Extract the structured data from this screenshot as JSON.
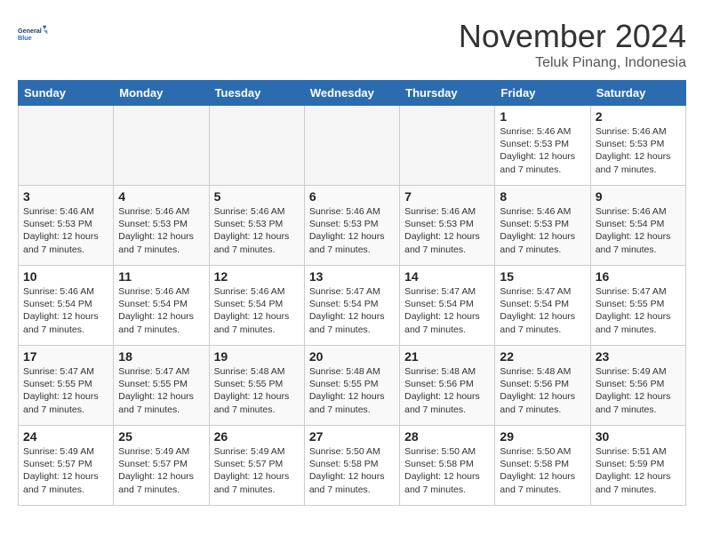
{
  "logo": {
    "line1": "General",
    "line2": "Blue"
  },
  "title": "November 2024",
  "location": "Teluk Pinang, Indonesia",
  "weekdays": [
    "Sunday",
    "Monday",
    "Tuesday",
    "Wednesday",
    "Thursday",
    "Friday",
    "Saturday"
  ],
  "weeks": [
    [
      {
        "day": "",
        "empty": true
      },
      {
        "day": "",
        "empty": true
      },
      {
        "day": "",
        "empty": true
      },
      {
        "day": "",
        "empty": true
      },
      {
        "day": "",
        "empty": true
      },
      {
        "day": "1",
        "sunrise": "5:46 AM",
        "sunset": "5:53 PM",
        "daylight": "12 hours and 7 minutes."
      },
      {
        "day": "2",
        "sunrise": "5:46 AM",
        "sunset": "5:53 PM",
        "daylight": "12 hours and 7 minutes."
      }
    ],
    [
      {
        "day": "3",
        "sunrise": "5:46 AM",
        "sunset": "5:53 PM",
        "daylight": "12 hours and 7 minutes."
      },
      {
        "day": "4",
        "sunrise": "5:46 AM",
        "sunset": "5:53 PM",
        "daylight": "12 hours and 7 minutes."
      },
      {
        "day": "5",
        "sunrise": "5:46 AM",
        "sunset": "5:53 PM",
        "daylight": "12 hours and 7 minutes."
      },
      {
        "day": "6",
        "sunrise": "5:46 AM",
        "sunset": "5:53 PM",
        "daylight": "12 hours and 7 minutes."
      },
      {
        "day": "7",
        "sunrise": "5:46 AM",
        "sunset": "5:53 PM",
        "daylight": "12 hours and 7 minutes."
      },
      {
        "day": "8",
        "sunrise": "5:46 AM",
        "sunset": "5:53 PM",
        "daylight": "12 hours and 7 minutes."
      },
      {
        "day": "9",
        "sunrise": "5:46 AM",
        "sunset": "5:54 PM",
        "daylight": "12 hours and 7 minutes."
      }
    ],
    [
      {
        "day": "10",
        "sunrise": "5:46 AM",
        "sunset": "5:54 PM",
        "daylight": "12 hours and 7 minutes."
      },
      {
        "day": "11",
        "sunrise": "5:46 AM",
        "sunset": "5:54 PM",
        "daylight": "12 hours and 7 minutes."
      },
      {
        "day": "12",
        "sunrise": "5:46 AM",
        "sunset": "5:54 PM",
        "daylight": "12 hours and 7 minutes."
      },
      {
        "day": "13",
        "sunrise": "5:47 AM",
        "sunset": "5:54 PM",
        "daylight": "12 hours and 7 minutes."
      },
      {
        "day": "14",
        "sunrise": "5:47 AM",
        "sunset": "5:54 PM",
        "daylight": "12 hours and 7 minutes."
      },
      {
        "day": "15",
        "sunrise": "5:47 AM",
        "sunset": "5:54 PM",
        "daylight": "12 hours and 7 minutes."
      },
      {
        "day": "16",
        "sunrise": "5:47 AM",
        "sunset": "5:55 PM",
        "daylight": "12 hours and 7 minutes."
      }
    ],
    [
      {
        "day": "17",
        "sunrise": "5:47 AM",
        "sunset": "5:55 PM",
        "daylight": "12 hours and 7 minutes."
      },
      {
        "day": "18",
        "sunrise": "5:47 AM",
        "sunset": "5:55 PM",
        "daylight": "12 hours and 7 minutes."
      },
      {
        "day": "19",
        "sunrise": "5:48 AM",
        "sunset": "5:55 PM",
        "daylight": "12 hours and 7 minutes."
      },
      {
        "day": "20",
        "sunrise": "5:48 AM",
        "sunset": "5:55 PM",
        "daylight": "12 hours and 7 minutes."
      },
      {
        "day": "21",
        "sunrise": "5:48 AM",
        "sunset": "5:56 PM",
        "daylight": "12 hours and 7 minutes."
      },
      {
        "day": "22",
        "sunrise": "5:48 AM",
        "sunset": "5:56 PM",
        "daylight": "12 hours and 7 minutes."
      },
      {
        "day": "23",
        "sunrise": "5:49 AM",
        "sunset": "5:56 PM",
        "daylight": "12 hours and 7 minutes."
      }
    ],
    [
      {
        "day": "24",
        "sunrise": "5:49 AM",
        "sunset": "5:57 PM",
        "daylight": "12 hours and 7 minutes."
      },
      {
        "day": "25",
        "sunrise": "5:49 AM",
        "sunset": "5:57 PM",
        "daylight": "12 hours and 7 minutes."
      },
      {
        "day": "26",
        "sunrise": "5:49 AM",
        "sunset": "5:57 PM",
        "daylight": "12 hours and 7 minutes."
      },
      {
        "day": "27",
        "sunrise": "5:50 AM",
        "sunset": "5:58 PM",
        "daylight": "12 hours and 7 minutes."
      },
      {
        "day": "28",
        "sunrise": "5:50 AM",
        "sunset": "5:58 PM",
        "daylight": "12 hours and 7 minutes."
      },
      {
        "day": "29",
        "sunrise": "5:50 AM",
        "sunset": "5:58 PM",
        "daylight": "12 hours and 7 minutes."
      },
      {
        "day": "30",
        "sunrise": "5:51 AM",
        "sunset": "5:59 PM",
        "daylight": "12 hours and 7 minutes."
      }
    ]
  ],
  "labels": {
    "sunrise": "Sunrise:",
    "sunset": "Sunset:",
    "daylight": "Daylight:"
  }
}
